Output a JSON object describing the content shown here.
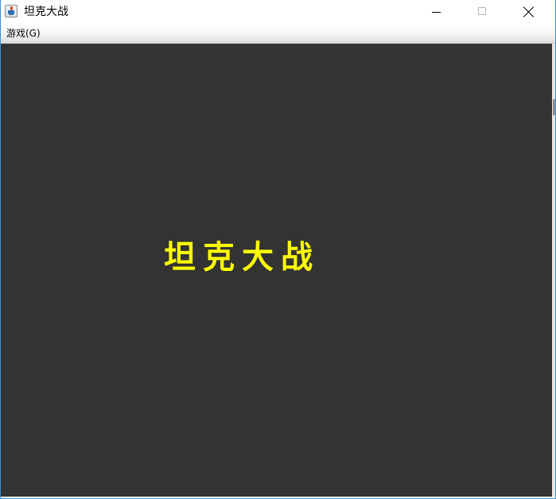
{
  "window": {
    "title": "坦克大战",
    "icon": "java-icon"
  },
  "menubar": {
    "items": [
      {
        "label": "游戏(G)"
      }
    ]
  },
  "canvas": {
    "background": "#333333",
    "title_text": "坦克大战",
    "title_color": "#ffff00"
  }
}
